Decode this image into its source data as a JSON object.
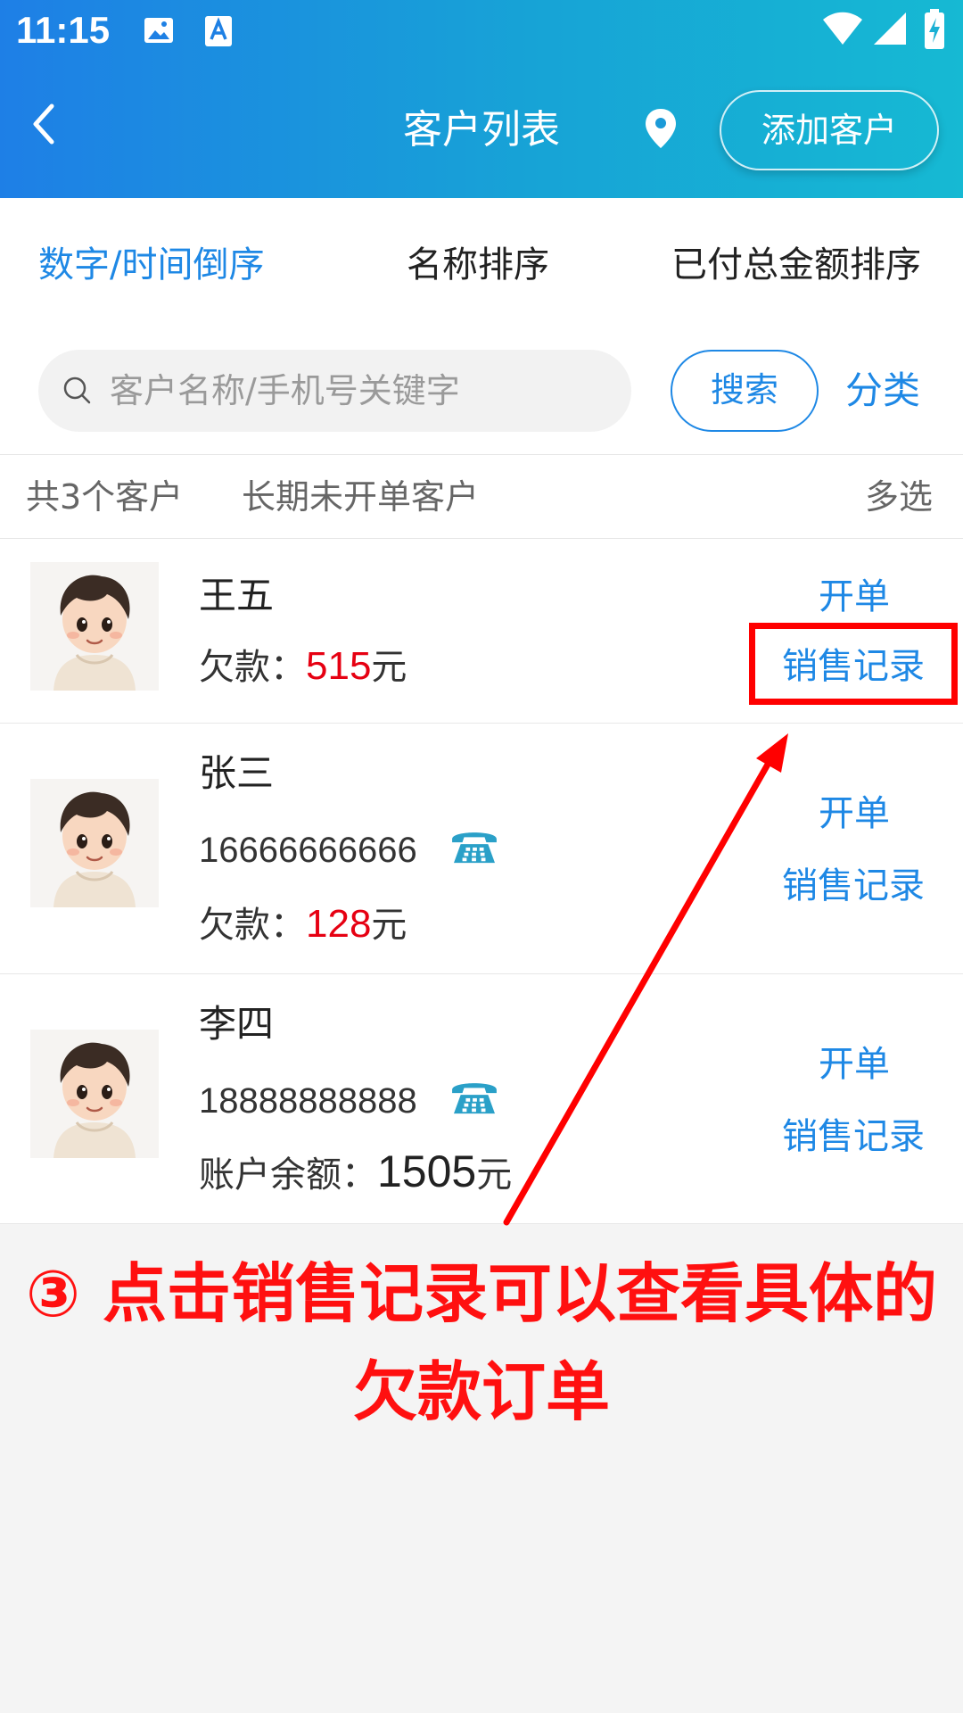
{
  "status_bar": {
    "time": "11:15"
  },
  "header": {
    "title": "客户列表",
    "add_button": "添加客户"
  },
  "sort_tabs": [
    {
      "label": "数字/时间倒序",
      "active": true
    },
    {
      "label": "名称排序",
      "active": false
    },
    {
      "label": "已付总金额排序",
      "active": false
    }
  ],
  "search": {
    "placeholder": "客户名称/手机号关键字",
    "button": "搜索",
    "category": "分类"
  },
  "summary": {
    "count": "共3个客户",
    "inactive": "长期未开单客户",
    "multi": "多选"
  },
  "customers": [
    {
      "name": "王五",
      "debt_label": "欠款：",
      "debt_value": "515",
      "unit": "元",
      "open": "开单",
      "sales": "销售记录"
    },
    {
      "name": "张三",
      "phone": "16666666666",
      "debt_label": "欠款：",
      "debt_value": "128",
      "unit": "元",
      "open": "开单",
      "sales": "销售记录"
    },
    {
      "name": "李四",
      "phone": "18888888888",
      "balance_label": "账户余额：",
      "balance_value": "1505",
      "unit": "元",
      "open": "开单",
      "sales": "销售记录"
    }
  ],
  "annotation": {
    "line1": "③ 点击销售记录可以查看具体的",
    "line2": "欠款订单"
  },
  "colors": {
    "accent": "#1e88e5",
    "debt": "#e60012",
    "annotation": "#ff0000",
    "phone_icon": "#2aa0c8"
  }
}
